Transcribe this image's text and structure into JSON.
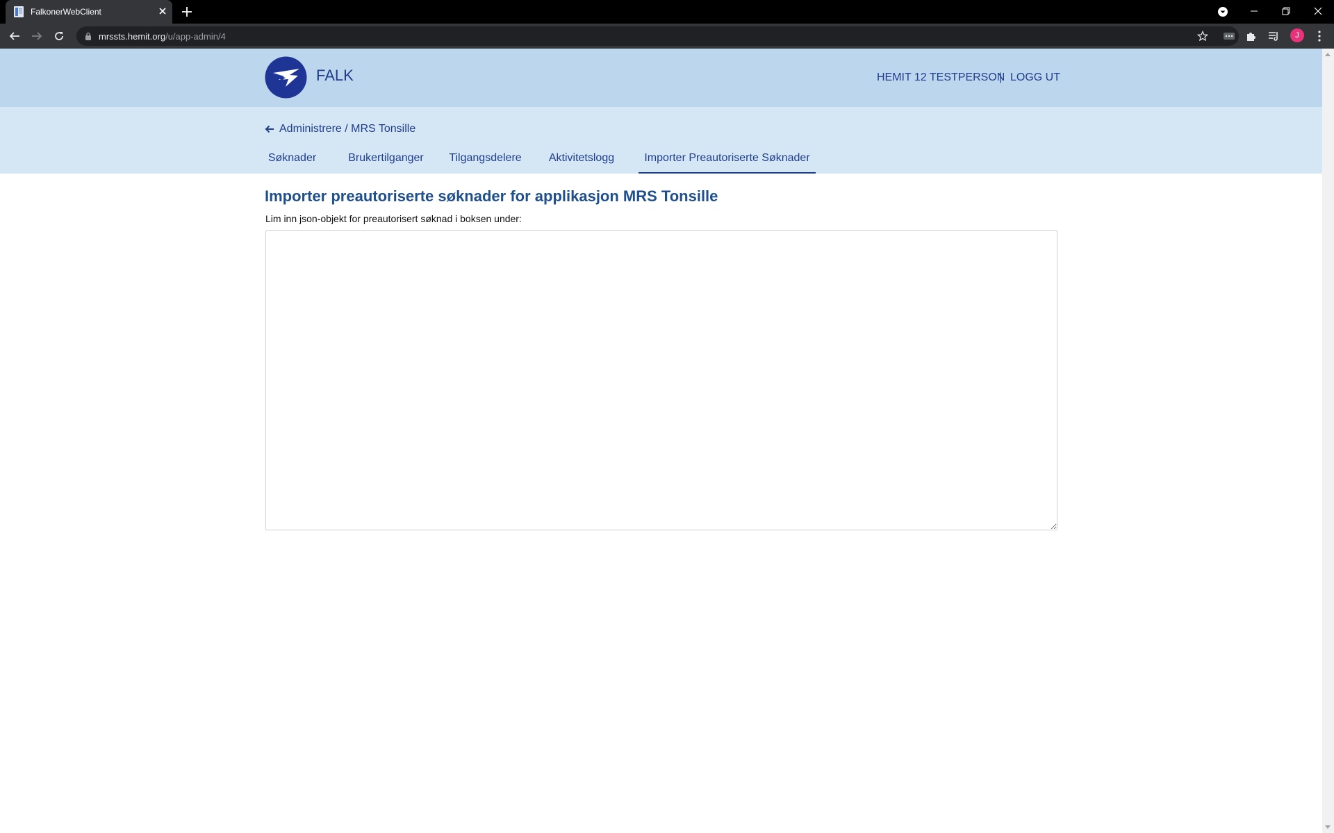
{
  "browser": {
    "tab_title": "FalkonerWebClient",
    "url_host": "mrssts.hemit.org",
    "url_path": "/u/app-admin/4",
    "avatar_initial": "J",
    "avatar_color": "#e8337a"
  },
  "header": {
    "brand": "FALK",
    "user_name": "HEMIT 12 TESTPERSON",
    "separator": "|",
    "logout_label": "LOGG UT"
  },
  "breadcrumb": {
    "text": "Administrere / MRS Tonsille"
  },
  "tabs": [
    {
      "label": "Søknader",
      "active": false
    },
    {
      "label": "Brukertilganger",
      "active": false
    },
    {
      "label": "Tilgangsdelere",
      "active": false
    },
    {
      "label": "Aktivitetslogg",
      "active": false
    },
    {
      "label": "Importer Preautoriserte Søknader",
      "active": true
    }
  ],
  "main": {
    "title": "Importer preautoriserte søknader for applikasjon MRS Tonsille",
    "description": "Lim inn json-objekt for preautorisert søknad i boksen under:",
    "json_value": ""
  },
  "colors": {
    "header_bg": "#bcd6ee",
    "subheader_bg": "#d5e6f5",
    "accent": "#1f3e8c"
  }
}
